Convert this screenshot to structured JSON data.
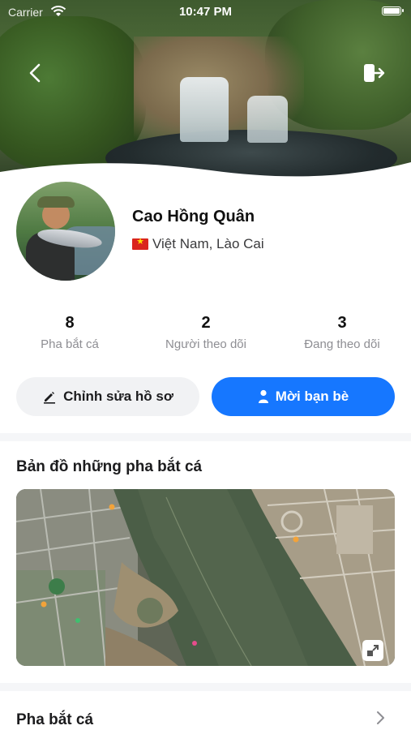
{
  "status_bar": {
    "carrier": "Carrier",
    "time": "10:47 PM"
  },
  "hero": {
    "back_icon": "chevron-left-icon",
    "logout_icon": "logout-icon"
  },
  "profile": {
    "name": "Cao Hồng Quân",
    "location": "Việt Nam, Lào Cai",
    "flag_icon": "vietnam-flag-icon"
  },
  "stats": [
    {
      "value": "8",
      "label": "Pha bắt cá"
    },
    {
      "value": "2",
      "label": "Người theo dõi"
    },
    {
      "value": "3",
      "label": "Đang theo dõi"
    }
  ],
  "actions": {
    "edit_label": "Chỉnh sửa hồ sơ",
    "invite_label": "Mời bạn bè",
    "accent": "#1677ff"
  },
  "map_section": {
    "title": "Bản đồ những pha bắt cá",
    "expand_icon": "expand-icon"
  },
  "catches_section": {
    "title": "Pha bắt cá",
    "chevron_icon": "chevron-right-icon"
  }
}
